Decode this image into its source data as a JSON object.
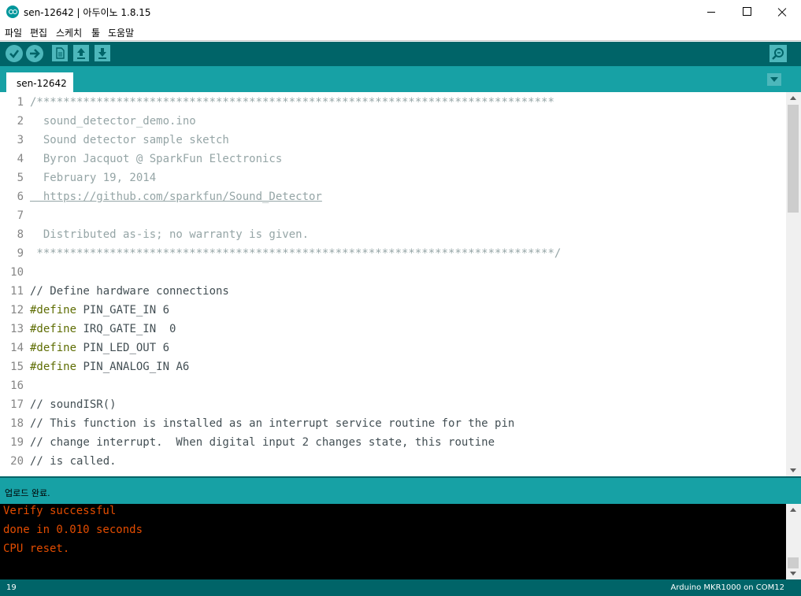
{
  "window": {
    "title": "sen-12642 | 아두이노 1.8.15"
  },
  "menu": [
    "파일",
    "편집",
    "스케치",
    "툴",
    "도움말"
  ],
  "toolbar": {
    "icons": [
      "verify-icon",
      "upload-icon",
      "new-icon",
      "open-icon",
      "save-icon",
      "serial-monitor-icon"
    ],
    "accent": "#006468",
    "button_color": "#4db7bb"
  },
  "tabs": [
    {
      "label": "sen-12642"
    }
  ],
  "editor": {
    "line_numbers": [
      "1",
      "2",
      "3",
      "4",
      "5",
      "6",
      "7",
      "8",
      "9",
      "10",
      "11",
      "12",
      "13",
      "14",
      "15",
      "16",
      "17",
      "18",
      "19",
      "20"
    ],
    "lines": [
      "/******************************************************************************",
      "  sound_detector_demo.ino",
      "  Sound detector sample sketch",
      "  Byron Jacquot @ SparkFun Electronics",
      "  February 19, 2014",
      "  https://github.com/sparkfun/Sound_Detector",
      "",
      "  Distributed as-is; no warranty is given.",
      " ******************************************************************************/",
      "",
      "// Define hardware connections",
      "#define PIN_GATE_IN 6",
      "#define IRQ_GATE_IN  0",
      "#define PIN_LED_OUT 6",
      "#define PIN_ANALOG_IN A6",
      "",
      "// soundISR()",
      "// This function is installed as an interrupt service routine for the pin",
      "// change interrupt.  When digital input 2 changes state, this routine",
      "// is called."
    ],
    "define_keyword": "#define",
    "define_rest": [
      " PIN_GATE_IN 6",
      " IRQ_GATE_IN  0",
      " PIN_LED_OUT 6",
      " PIN_ANALOG_IN A6"
    ]
  },
  "status": {
    "message": "업로드 완료."
  },
  "console": {
    "lines": [
      "Verify successful",
      "done in 0.010 seconds",
      "CPU reset."
    ],
    "text_color": "#e34c00"
  },
  "footer": {
    "line": "19",
    "board": "Arduino MKR1000 on COM12"
  }
}
